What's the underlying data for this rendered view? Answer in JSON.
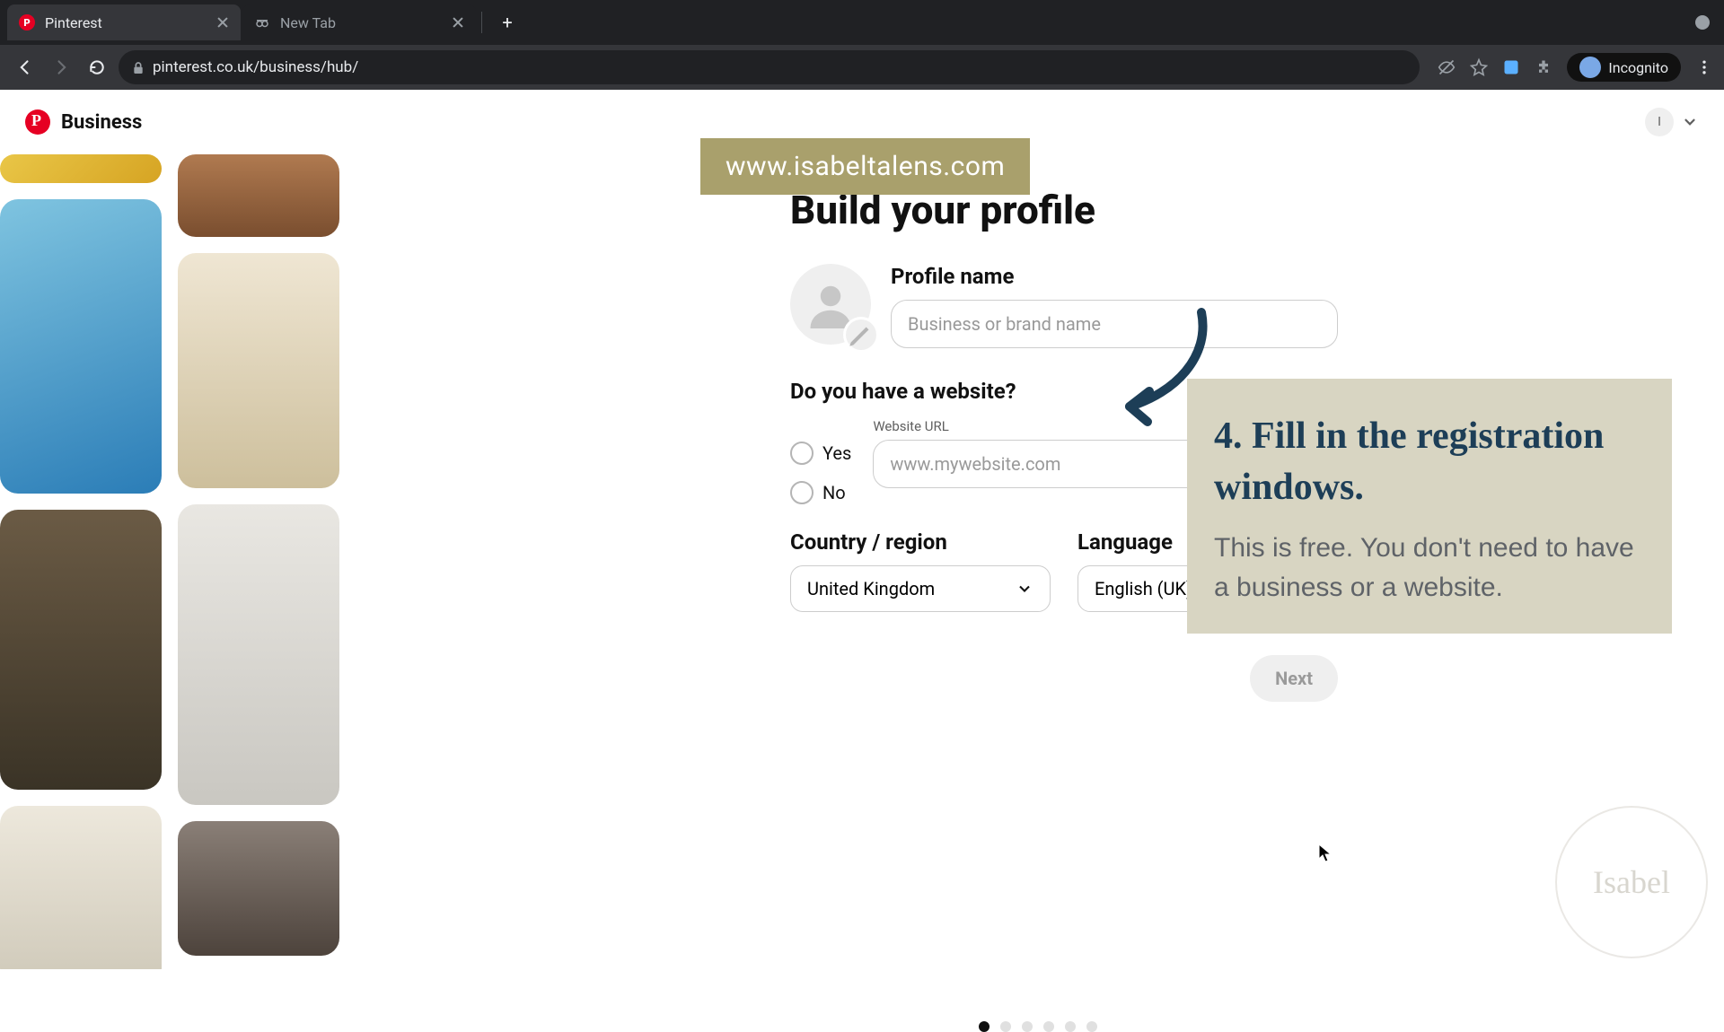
{
  "browser": {
    "tabs": [
      {
        "title": "Pinterest",
        "active": true
      },
      {
        "title": "New Tab",
        "active": false
      }
    ],
    "url": "pinterest.co.uk/business/hub/",
    "incognito_label": "Incognito"
  },
  "header": {
    "brand": "Business",
    "user_initial": "I"
  },
  "form": {
    "heading": "Build your profile",
    "profile_name_label": "Profile name",
    "profile_name_placeholder": "Business or brand name",
    "website_question": "Do you have a website?",
    "radio_yes": "Yes",
    "radio_no": "No",
    "website_url_label": "Website URL",
    "website_url_placeholder": "www.mywebsite.com",
    "country_label": "Country / region",
    "country_value": "United Kingdom",
    "language_label": "Language",
    "language_value": "English (UK)",
    "next_label": "Next"
  },
  "pagination": {
    "total": 6,
    "active": 1
  },
  "overlay": {
    "url_banner": "www.isabeltalens.com",
    "callout_heading": "4. Fill in the registration windows.",
    "callout_body": "This is free. You don't need to have a business or a website."
  },
  "colors": {
    "pinterest_red": "#e60023",
    "callout_bg": "#d8d5c2",
    "callout_heading": "#1d3e57",
    "banner_bg": "#a9a06c"
  }
}
